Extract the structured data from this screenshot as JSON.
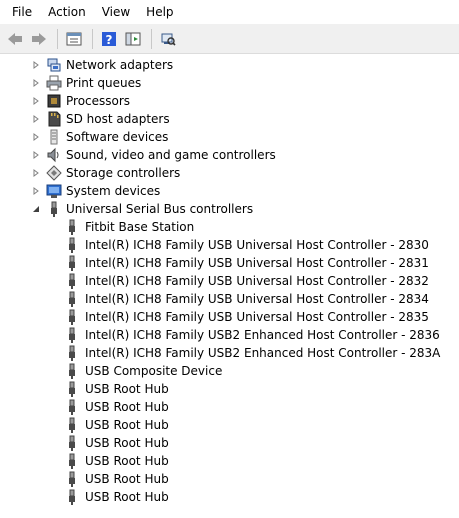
{
  "menu": [
    "File",
    "Action",
    "View",
    "Help"
  ],
  "toolbar": [
    "back-arrow-icon",
    "forward-arrow-icon",
    "properties-icon",
    "help-icon",
    "console-tree-icon",
    "scan-hardware-icon"
  ],
  "categories": [
    {
      "label": "Network adapters",
      "icon": "network-adapter-icon",
      "expanded": false
    },
    {
      "label": "Print queues",
      "icon": "printer-icon",
      "expanded": false
    },
    {
      "label": "Processors",
      "icon": "processor-icon",
      "expanded": false
    },
    {
      "label": "SD host adapters",
      "icon": "sd-card-icon",
      "expanded": false
    },
    {
      "label": "Software devices",
      "icon": "software-device-icon",
      "expanded": false
    },
    {
      "label": "Sound, video and game controllers",
      "icon": "speaker-icon",
      "expanded": false
    },
    {
      "label": "Storage controllers",
      "icon": "storage-controller-icon",
      "expanded": false
    },
    {
      "label": "System devices",
      "icon": "computer-icon",
      "expanded": false
    },
    {
      "label": "Universal Serial Bus controllers",
      "icon": "usb-icon",
      "expanded": true
    }
  ],
  "usb_devices": [
    "Fitbit Base Station",
    "Intel(R) ICH8 Family USB Universal Host Controller - 2830",
    "Intel(R) ICH8 Family USB Universal Host Controller - 2831",
    "Intel(R) ICH8 Family USB Universal Host Controller - 2832",
    "Intel(R) ICH8 Family USB Universal Host Controller - 2834",
    "Intel(R) ICH8 Family USB Universal Host Controller - 2835",
    "Intel(R) ICH8 Family USB2 Enhanced Host Controller - 2836",
    "Intel(R) ICH8 Family USB2 Enhanced Host Controller - 283A",
    "USB Composite Device",
    "USB Root Hub",
    "USB Root Hub",
    "USB Root Hub",
    "USB Root Hub",
    "USB Root Hub",
    "USB Root Hub",
    "USB Root Hub"
  ],
  "colors": {
    "toolbar_bg": "#f0f0f0",
    "arrow_green": "#2e8b3a",
    "help_blue": "#2a5bd7"
  }
}
